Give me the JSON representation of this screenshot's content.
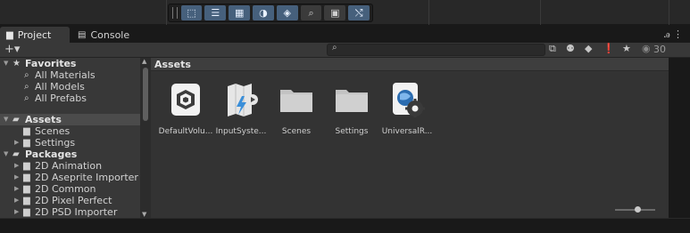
{
  "toolbar": {
    "tools": [
      {
        "icon": "rect-select-icon",
        "glyph": "⬚",
        "active": true
      },
      {
        "icon": "align-icon",
        "glyph": "☰",
        "active": true
      },
      {
        "icon": "grid-icon",
        "glyph": "▦",
        "active": true
      },
      {
        "icon": "shading-icon",
        "glyph": "◑",
        "active": true
      },
      {
        "icon": "layers-icon",
        "glyph": "◈",
        "active": true
      },
      {
        "icon": "search-icon",
        "glyph": "⌕",
        "active": false
      },
      {
        "icon": "camera-icon",
        "glyph": "▣",
        "active": false
      },
      {
        "icon": "gizmo-icon",
        "glyph": "⤭",
        "active": true
      }
    ]
  },
  "tabs": {
    "project": "Project",
    "console": "Console",
    "lock_glyph": "ꭿ ⋮"
  },
  "panel": {
    "add_glyph": "+▾",
    "search_placeholder": "",
    "hidden_count": "30"
  },
  "tree": {
    "favorites": {
      "label": "Favorites",
      "items": [
        "All Materials",
        "All Models",
        "All Prefabs"
      ]
    },
    "assets": {
      "label": "Assets",
      "items": [
        "Scenes",
        "Settings"
      ]
    },
    "packages": {
      "label": "Packages",
      "items": [
        "2D Animation",
        "2D Aseprite Importer",
        "2D Common",
        "2D Pixel Perfect",
        "2D PSD Importer"
      ]
    }
  },
  "content": {
    "breadcrumb": "Assets",
    "assets": [
      {
        "name": "DefaultVolu...",
        "icon": "volume-profile-icon"
      },
      {
        "name": "InputSyste...",
        "icon": "input-actions-icon"
      },
      {
        "name": "Scenes",
        "icon": "folder-icon"
      },
      {
        "name": "Settings",
        "icon": "folder-icon"
      },
      {
        "name": "UniversalR...",
        "icon": "render-pipeline-asset-icon"
      }
    ]
  }
}
